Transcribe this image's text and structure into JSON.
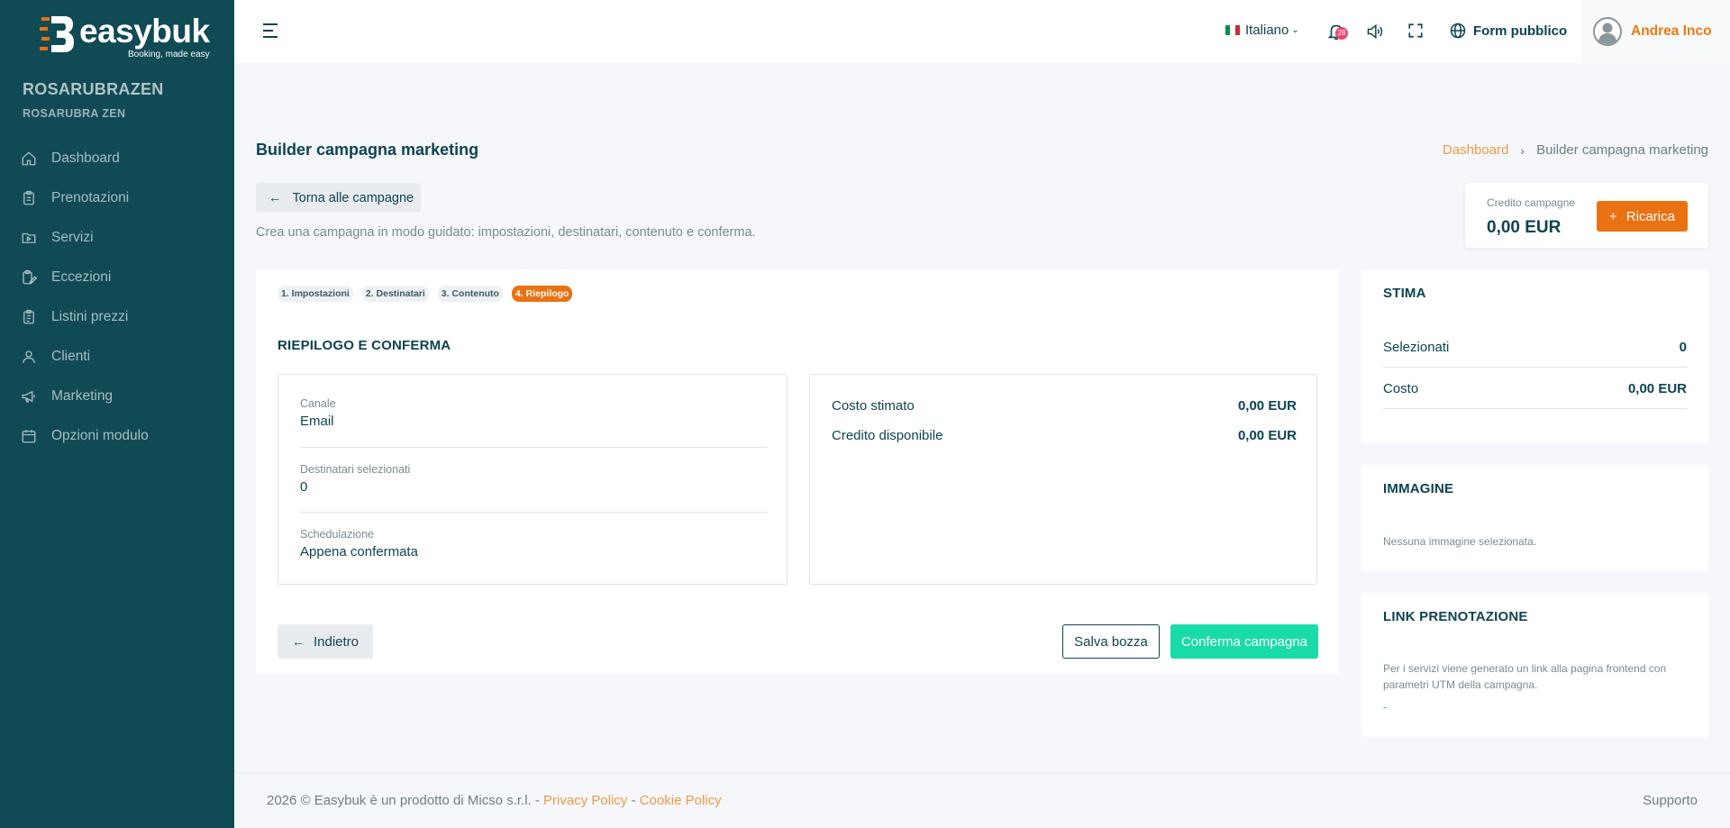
{
  "brand": {
    "name": "easybuk",
    "tagline": "Booking, made easy"
  },
  "account": {
    "name": "ROSARUBRAZEN",
    "subname": "ROSARUBRA ZEN"
  },
  "sidebar": {
    "items": [
      {
        "label": "Dashboard",
        "icon": "home-icon"
      },
      {
        "label": "Prenotazioni",
        "icon": "clipboard-icon"
      },
      {
        "label": "Servizi",
        "icon": "folder-play-icon"
      },
      {
        "label": "Eccezioni",
        "icon": "clipboard-edit-icon"
      },
      {
        "label": "Listini prezzi",
        "icon": "clipboard-list-icon"
      },
      {
        "label": "Clienti",
        "icon": "user-icon"
      },
      {
        "label": "Marketing",
        "icon": "megaphone-icon"
      },
      {
        "label": "Opzioni modulo",
        "icon": "calendar-icon"
      }
    ]
  },
  "topbar": {
    "language": "Italiano",
    "notifications_count": "28",
    "public_form_label": "Form pubblico",
    "user_name": "Andrea Inco"
  },
  "page": {
    "title": "Builder campagna marketing",
    "breadcrumb": {
      "home": "Dashboard",
      "current": "Builder campagna marketing"
    },
    "back_label": "Torna alle campagne",
    "intro": "Crea una campagna in modo guidato: impostazioni, destinatari, contenuto e conferma."
  },
  "credit": {
    "label": "Credito campagne",
    "value": "0,00 EUR",
    "recharge_label": "Ricarica"
  },
  "wizard": {
    "steps": [
      {
        "label": "1. Impostazioni",
        "active": false
      },
      {
        "label": "2. Destinatari",
        "active": false
      },
      {
        "label": "3. Contenuto",
        "active": false
      },
      {
        "label": "4. Riepilogo",
        "active": true
      }
    ],
    "section_title": "RIEPILOGO E CONFERMA",
    "summary": [
      {
        "label": "Canale",
        "value": "Email"
      },
      {
        "label": "Destinatari selezionati",
        "value": "0"
      },
      {
        "label": "Schedulazione",
        "value": "Appena confermata"
      }
    ],
    "costs": [
      {
        "label": "Costo stimato",
        "value": "0,00 EUR"
      },
      {
        "label": "Credito disponibile",
        "value": "0,00 EUR"
      }
    ],
    "prev_label": "Indietro",
    "draft_label": "Salva bozza",
    "confirm_label": "Conferma campagna"
  },
  "estimate": {
    "title": "STIMA",
    "rows": [
      {
        "label": "Selezionati",
        "value": "0"
      },
      {
        "label": "Costo",
        "value": "0,00 EUR"
      }
    ]
  },
  "image_panel": {
    "title": "IMMAGINE",
    "text": "Nessuna immagine selezionata."
  },
  "booking_link": {
    "title": "LINK PRENOTAZIONE",
    "text": "Per i servizi viene generato un link alla pagina frontend con parametri UTM della campagna.",
    "value": "-"
  },
  "footer": {
    "prefix": "2026 © Easybuk è un prodotto di Micso s.r.l. -",
    "privacy": "Privacy Policy",
    "separator": "-",
    "cookie": "Cookie Policy",
    "support": "Supporto"
  },
  "colors": {
    "sidebar": "#0f4a55",
    "accent_orange": "#ea7212",
    "confirm_green": "#19dba8",
    "text_dark": "#0d4451"
  }
}
